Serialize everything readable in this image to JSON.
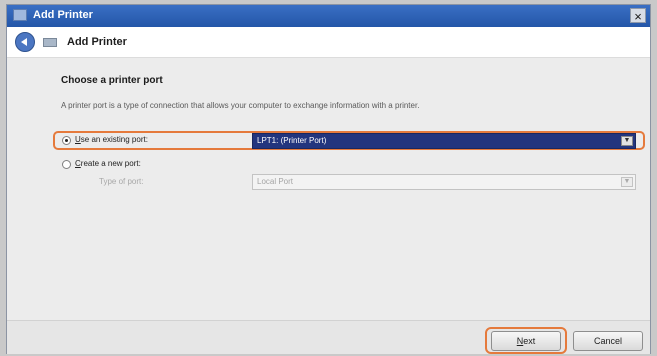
{
  "window": {
    "title": "Add Printer",
    "close_glyph": "×"
  },
  "header": {
    "title": "Add Printer"
  },
  "content": {
    "section_title": "Choose a printer port",
    "description": "A printer port is a type of connection that allows your computer to exchange information with a printer.",
    "options": [
      {
        "label_prefix": "",
        "label_underline": "U",
        "label_rest": "se an existing port:",
        "selected": true,
        "value": "LPT1: (Printer Port)"
      },
      {
        "label_prefix": "",
        "label_underline": "C",
        "label_rest": "reate a new port:",
        "selected": false
      }
    ],
    "type_of_port_label": "Type of port:",
    "type_of_port_value": "Local Port"
  },
  "footer": {
    "next_underline": "N",
    "next_rest": "ext",
    "cancel_label": "Cancel"
  },
  "colors": {
    "title_bar": "#2456a8",
    "selection": "#23357e",
    "annotation": "#e57a3c"
  },
  "icons": {
    "back": "back-arrow-icon",
    "printer": "printer-icon",
    "close": "close-icon",
    "dropdown": "chevron-down-icon"
  }
}
